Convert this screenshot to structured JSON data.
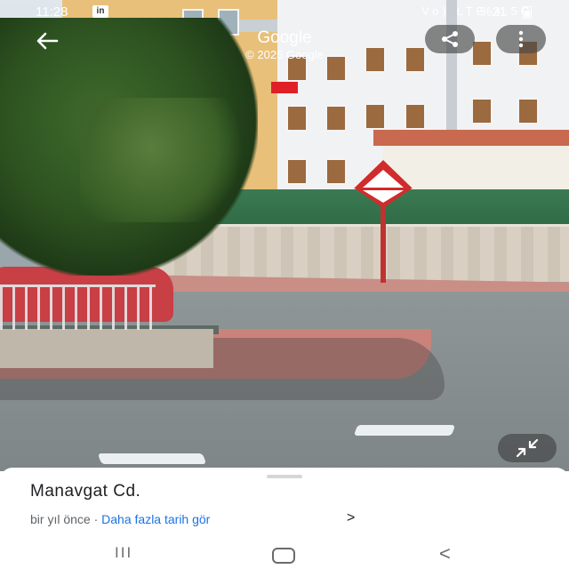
{
  "status_bar": {
    "time": "11:28",
    "linkedin_badge": "in",
    "network_icons": "Vo) LTE 4.5G",
    "battery": "%21"
  },
  "top_bar": {
    "title": "Google",
    "copyright": "© 2025 Google",
    "back_icon": "arrow-left-icon",
    "share_icon": "share-icon",
    "more_icon": "more-vert-icon"
  },
  "overlay": {
    "compress_icon": "collapse-arrows-icon"
  },
  "card": {
    "place_name": "Manavgat Cd.",
    "date_text": "bir yıl önce",
    "separator": "·",
    "link_text": "Daha fazla tarih gör",
    "chevron": ">"
  },
  "nav_bar": {
    "recent": "III",
    "back": "<"
  }
}
